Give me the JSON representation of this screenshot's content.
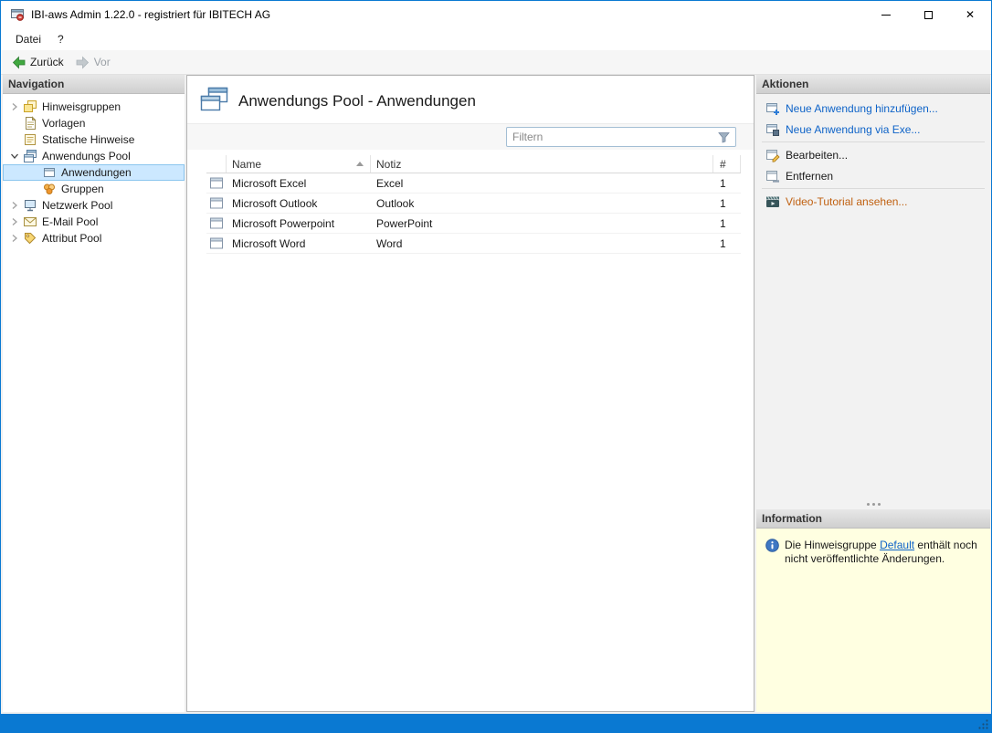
{
  "colors": {
    "accent": "#0078d7",
    "selection_bg": "#cce8ff",
    "link": "#0e63c8",
    "video_link": "#c06010",
    "info_bg": "#ffffe1"
  },
  "window": {
    "title": "IBI-aws Admin 1.22.0 - registriert für IBITECH AG"
  },
  "menubar": {
    "items": [
      "Datei",
      "?"
    ]
  },
  "toolbar": {
    "back_label": "Zurück",
    "forward_label": "Vor"
  },
  "navigation": {
    "header": "Navigation",
    "items": [
      {
        "label": "Hinweisgruppen",
        "state": "collapsed",
        "level": 0,
        "selected": false
      },
      {
        "label": "Vorlagen",
        "state": "leaf",
        "level": 0,
        "selected": false
      },
      {
        "label": "Statische Hinweise",
        "state": "leaf",
        "level": 0,
        "selected": false
      },
      {
        "label": "Anwendungs Pool",
        "state": "expanded",
        "level": 0,
        "selected": false
      },
      {
        "label": "Anwendungen",
        "state": "leaf",
        "level": 1,
        "selected": true
      },
      {
        "label": "Gruppen",
        "state": "leaf",
        "level": 1,
        "selected": false
      },
      {
        "label": "Netzwerk Pool",
        "state": "collapsed",
        "level": 0,
        "selected": false
      },
      {
        "label": "E-Mail Pool",
        "state": "collapsed",
        "level": 0,
        "selected": false
      },
      {
        "label": "Attribut Pool",
        "state": "collapsed",
        "level": 0,
        "selected": false
      }
    ]
  },
  "main": {
    "title": "Anwendungs Pool - Anwendungen",
    "filter_placeholder": "Filtern",
    "table": {
      "columns": [
        "Name",
        "Notiz",
        "#"
      ],
      "sort": {
        "column": "Name",
        "direction": "ascending"
      },
      "rows": [
        {
          "name": "Microsoft Excel",
          "notiz": "Excel",
          "count": "1"
        },
        {
          "name": "Microsoft Outlook",
          "notiz": "Outlook",
          "count": "1"
        },
        {
          "name": "Microsoft Powerpoint",
          "notiz": "PowerPoint",
          "count": "1"
        },
        {
          "name": "Microsoft Word",
          "notiz": "Word",
          "count": "1"
        }
      ]
    }
  },
  "actions": {
    "header": "Aktionen",
    "items": [
      {
        "label": "Neue Anwendung hinzufügen...",
        "style": "link"
      },
      {
        "label": "Neue Anwendung via Exe...",
        "style": "link"
      },
      {
        "label": "Bearbeiten...",
        "style": "default"
      },
      {
        "label": "Entfernen",
        "style": "default"
      },
      {
        "label": "Video-Tutorial ansehen...",
        "style": "video"
      }
    ]
  },
  "information": {
    "header": "Information",
    "text_before": "Die Hinweisgruppe ",
    "link_label": "Default",
    "text_after": " enthält noch nicht veröffentlichte Änderungen."
  }
}
